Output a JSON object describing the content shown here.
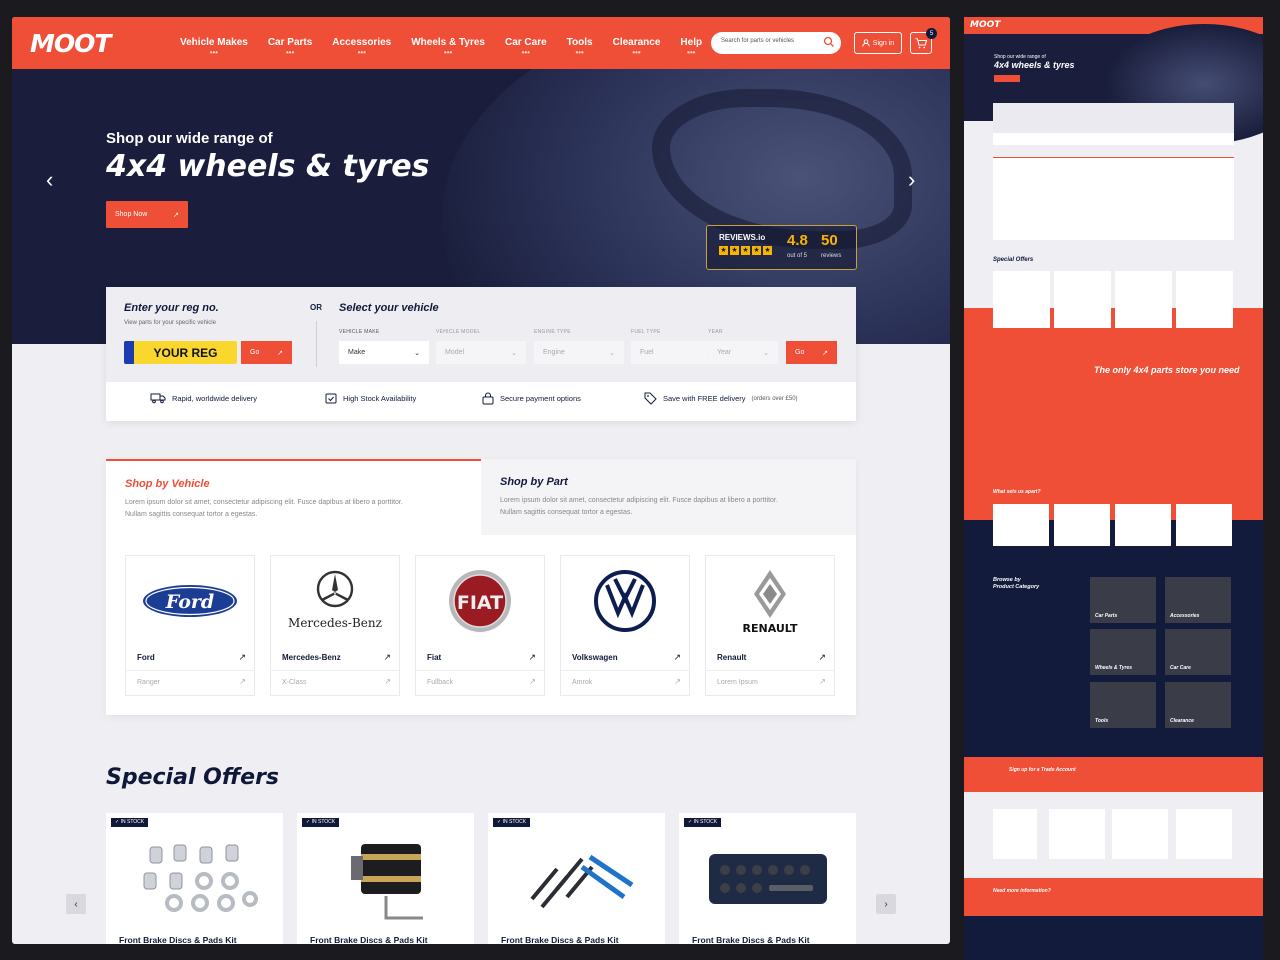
{
  "header": {
    "logo": "MOOT",
    "nav": [
      "Vehicle Makes",
      "Car Parts",
      "Accessories",
      "Wheels & Tyres",
      "Car Care",
      "Tools",
      "Clearance",
      "Help"
    ],
    "search_placeholder": "Search for parts or vehicles",
    "signin_label": "Sign in",
    "cart_count": "5"
  },
  "hero": {
    "subtitle": "Shop our wide range of",
    "title": "4x4 wheels & tyres",
    "cta_label": "Shop Now",
    "reviews": {
      "logo": "REVIEWS.io",
      "score": "4.8",
      "out_of": "out of 5",
      "count": "50",
      "count_label": "reviews"
    }
  },
  "finder": {
    "reg_title": "Enter your reg no.",
    "reg_subtitle": "View parts for your specific vehicle",
    "reg_plate": "YOUR REG",
    "go_label": "Go",
    "or_label": "OR",
    "select_title": "Select your vehicle",
    "fields": [
      {
        "label": "VEHICLE MAKE",
        "value": "Make"
      },
      {
        "label": "VEHICLE MODEL",
        "value": "Model"
      },
      {
        "label": "ENGINE TYPE",
        "value": "Engine"
      },
      {
        "label": "FUEL TYPE",
        "value": "Fuel"
      },
      {
        "label": "YEAR",
        "value": "Year"
      }
    ],
    "usps": [
      {
        "icon": "truck-icon",
        "label": "Rapid, worldwide delivery",
        "note": ""
      },
      {
        "icon": "calendar-check-icon",
        "label": "High Stock Availability",
        "note": ""
      },
      {
        "icon": "lock-icon",
        "label": "Secure payment options",
        "note": ""
      },
      {
        "icon": "tag-icon",
        "label": "Save with FREE delivery",
        "note": "(orders over £50)"
      }
    ]
  },
  "shop_by": {
    "vehicle_title": "Shop by Vehicle",
    "vehicle_desc": "Lorem ipsum dolor sit amet, consectetur adipiscing elit. Fusce dapibus at libero a porttitor. Nullam sagittis consequat tortor a egestas.",
    "part_title": "Shop by Part",
    "part_desc": "Lorem ipsum dolor sit amet, consectetur adipiscing elit. Fusce dapibus at libero a porttitor. Nullam sagittis consequat tortor a egestas.",
    "brands": [
      {
        "name": "Ford",
        "model": "Ranger",
        "logo_text": "Ford"
      },
      {
        "name": "Mercedes-Benz",
        "model": "X-Class",
        "logo_text": "Mercedes-Benz"
      },
      {
        "name": "Fiat",
        "model": "Fullback",
        "logo_text": "FIAT"
      },
      {
        "name": "Volkswagen",
        "model": "Amrok",
        "logo_text": "VW"
      },
      {
        "name": "Renault",
        "model": "Lorem Ipsum",
        "logo_text": "RENAULT"
      }
    ]
  },
  "offers": {
    "title": "Special Offers",
    "stock_label": "IN STOCK",
    "products": [
      {
        "title": "Front Brake Discs & Pads Kit",
        "image": "wheel-nuts-icon"
      },
      {
        "title": "Front Brake Discs & Pads Kit",
        "image": "piston-ring-compressor-icon"
      },
      {
        "title": "Front Brake Discs & Pads Kit",
        "image": "circlip-pliers-icon"
      },
      {
        "title": "Front Brake Discs & Pads Kit",
        "image": "socket-set-icon"
      }
    ]
  },
  "thumbnail": {
    "logo": "MOOT",
    "hero_sub": "Shop our wide range of",
    "hero_title": "4x4 wheels & tyres",
    "offers_title": "Special Offers",
    "promo_title": "The only 4x4 parts store you need",
    "apart_title": "What sets us apart?",
    "browse_title": "Browse by Product Category",
    "categories": [
      "Car Parts",
      "Accessories",
      "Wheels & Tyres",
      "Car Care",
      "Tools",
      "Clearance"
    ],
    "trade_title": "Sign up for a Trade Account",
    "info_title": "Need more information?"
  },
  "colors": {
    "brand": "#ee4f36",
    "navy": "#10183a",
    "star": "#f7b500"
  }
}
